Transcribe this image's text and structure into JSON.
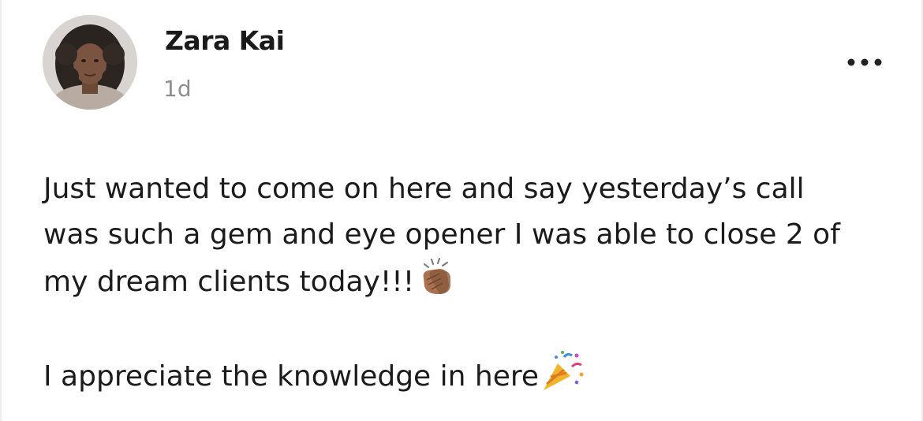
{
  "post": {
    "author": {
      "name": "Zara Kai",
      "avatar_icon": "profile-photo"
    },
    "time": "1d",
    "menu_icon": "more-horizontal-icon",
    "body": {
      "lines_paragraph_1": [
        "Just wanted to come on here and say yesterday’s call",
        "was such a gem and eye opener I was able to close 2 of",
        "my dream clients today!!!"
      ],
      "emoji_1": "clapping-hands-icon",
      "line_paragraph_2": "I appreciate the knowledge in here",
      "emoji_2": "party-popper-icon"
    }
  }
}
